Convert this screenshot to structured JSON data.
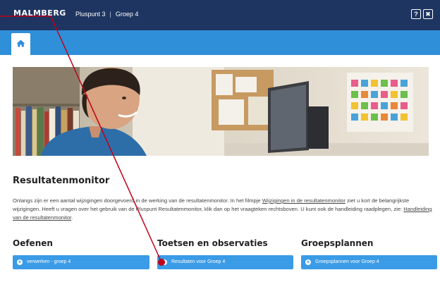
{
  "header": {
    "logo": "MALMBERG",
    "method": "Pluspunt 3",
    "separator": "|",
    "group": "Groep 4",
    "help_label": "?",
    "close_label": "✖"
  },
  "nav": {
    "home_icon": "home-icon"
  },
  "main": {
    "title": "Resultatenmonitor",
    "intro": {
      "part1": "Onlangs zijn er een aantal wijzigingen doorgevoerd in de werking van de resultatenmonitor. In het filmpje ",
      "link1": "Wijzigingen in de resultatenmonitor",
      "part2": " ziet u kort de belangrijkste wijzigingen. Heeft u vragen over het gebruik van de Pluspunt Resultatenmonitor, klik dan op het vraagteken rechtsboven. U kunt ook de handleiding raadplegen, zie: ",
      "link2": "Handleiding van de resultatenmonitor",
      "part3": "."
    },
    "sections": [
      {
        "title": "Oefenen",
        "button": "verwerken - groep 4"
      },
      {
        "title": "Toetsen en observaties",
        "button": "Resultaten voor Groep 4"
      },
      {
        "title": "Groepsplannen",
        "button": "Groepsplannen voor Groep 4"
      }
    ]
  },
  "colors": {
    "topbar": "#1f3561",
    "navbar": "#2f8fd9",
    "button": "#3a9be6",
    "annotation": "#c0001a"
  }
}
